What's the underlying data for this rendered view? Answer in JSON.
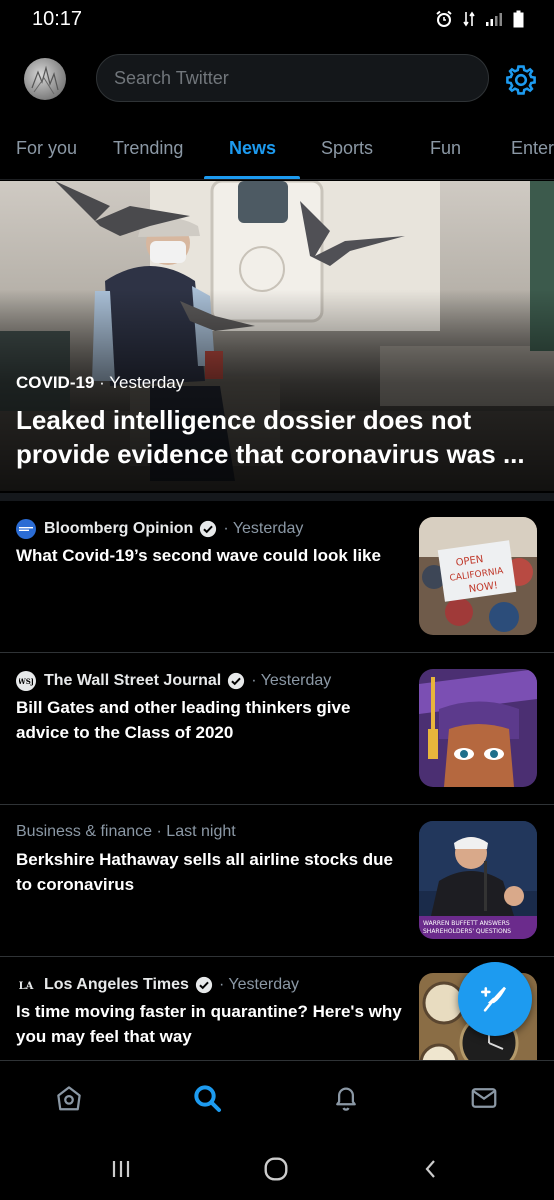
{
  "status_bar": {
    "time": "10:17"
  },
  "search": {
    "placeholder": "Search Twitter"
  },
  "tabs": [
    {
      "label": "For you"
    },
    {
      "label": "Trending"
    },
    {
      "label": "News",
      "active": true
    },
    {
      "label": "Sports"
    },
    {
      "label": "Fun"
    },
    {
      "label": "Enter"
    }
  ],
  "hero": {
    "category": "COVID-19",
    "separator": "·",
    "time": "Yesterday",
    "headline": "Leaked intelligence dossier does not provide evidence that coronavirus was ..."
  },
  "news": [
    {
      "source": "Bloomberg Opinion",
      "verified": true,
      "time": "· Yesterday",
      "headline": "What Covid-19’s second wave could look like",
      "logo": "Bloomberg",
      "thumb_sign_line1": "OPEN",
      "thumb_sign_line2": "CALIFORNIA",
      "thumb_sign_line3": "NOW!"
    },
    {
      "source": "The Wall Street Journal",
      "verified": true,
      "time": "· Yesterday",
      "headline": "Bill Gates and other leading thinkers give advice to the Class of 2020",
      "logo": "WSJ"
    },
    {
      "source": "Business & finance · Last night",
      "verified": false,
      "time": "",
      "headline": "Berkshire Hathaway sells all airline stocks due to coronavirus",
      "thumb_caption_line1": "WARREN BUFFETT ANSWERS",
      "thumb_caption_line2": "SHAREHOLDERS' QUESTIONS"
    },
    {
      "source": "Los Angeles Times",
      "verified": true,
      "time": "· Yesterday",
      "headline": "Is time moving faster in quarantine? Here's why you may feel that way",
      "logo": "LAT"
    }
  ],
  "colors": {
    "accent": "#1d9bf0",
    "background": "#000000",
    "secondary_text": "#8b98a5"
  },
  "icons": {
    "bottom_nav": [
      "home-icon",
      "search-icon",
      "notifications-bell-icon",
      "messages-envelope-icon"
    ],
    "system_nav": [
      "recent-apps-icon",
      "home-circle-icon",
      "back-chevron-icon"
    ]
  }
}
